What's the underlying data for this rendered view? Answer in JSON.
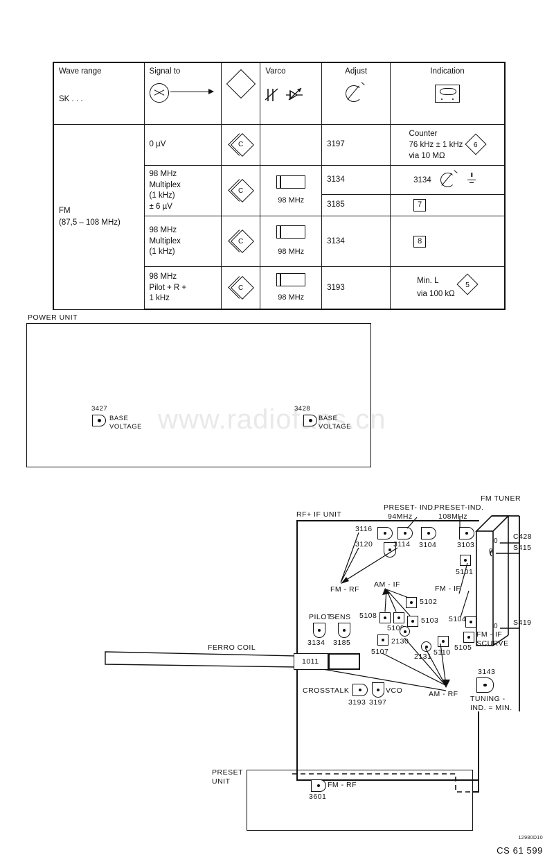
{
  "document": {
    "code_small": "12980D10",
    "code_large": "CS 61 599",
    "watermark": "www.radiofans.cn"
  },
  "alignment_table": {
    "headers": [
      {
        "label": "Wave range",
        "sub": "SK . . .",
        "icon": ""
      },
      {
        "label": "Signal to",
        "icon": "signal-generator-icon"
      },
      {
        "label": "",
        "icon": "diamond-icon"
      },
      {
        "label": "Varco",
        "icon": "varicap-symbols-icon"
      },
      {
        "label": "Adjust",
        "icon": "screwdriver-adjust-icon"
      },
      {
        "label": "Indication",
        "icon": "meter-icon"
      }
    ],
    "wave_range": {
      "band": "FM",
      "range": "(87,5 – 108 MHz)"
    },
    "rows": [
      {
        "signal": "0 µV",
        "connector": "C",
        "varco": "",
        "varco_freq": "",
        "adjust": "3197",
        "indication_lines": [
          "Counter",
          "76 kHz ± 1 kHz",
          "via 10 MΩ"
        ],
        "indication_badge": "6",
        "badge_shape": "diamond"
      },
      {
        "signal": "98 MHz\nMultiplex\n(1 kHz)\n± 6 µV",
        "signal_lines": [
          "98 MHz",
          "Multiplex",
          "(1 kHz)",
          "± 6 µV"
        ],
        "connector": "C",
        "varco": "coil",
        "varco_freq": "98 MHz",
        "adjust": "3134",
        "indication_value": "3134",
        "indication_symbols": [
          "screwdriver-adjust-icon",
          "ground-icon"
        ]
      },
      {
        "signal_lines": [],
        "adjust": "3185",
        "indication_badge": "7",
        "badge_shape": "square"
      },
      {
        "signal_lines": [
          "98 MHz",
          "Multiplex",
          "(1 kHz)"
        ],
        "connector": "C",
        "varco": "coil",
        "varco_freq": "98 MHz",
        "adjust": "3134",
        "indication_badge": "8",
        "badge_shape": "square"
      },
      {
        "signal_lines": [
          "98 MHz",
          "Pilot + R +",
          "1 kHz"
        ],
        "connector": "C",
        "varco": "coil",
        "varco_freq": "98 MHz",
        "adjust": "3193",
        "indication_lines": [
          "Min. L",
          "via 100 kΩ"
        ],
        "indication_badge": "5",
        "badge_shape": "diamond"
      }
    ]
  },
  "power_unit": {
    "title": "POWER  UNIT",
    "test_points": [
      {
        "id": "3427",
        "label_line1": "BASE",
        "label_line2": "VOLTAGE"
      },
      {
        "id": "3428",
        "label_line1": "BASE",
        "label_line2": "VOLTAGE"
      }
    ]
  },
  "rf_if_unit": {
    "title": "RF+ IF  UNIT",
    "fm_tuner_title": "FM  TUNER",
    "preset_unit_title_line1": "PRESET",
    "preset_unit_title_line2": "UNIT",
    "ferro_coil_label": "FERRO  COIL",
    "ferrite_part": "1011",
    "preset_ind_94": {
      "line1": "PRESET- IND.",
      "line2": "94MHz"
    },
    "preset_ind_108": {
      "line1": "PRESET-IND.",
      "line2": "108MHz"
    },
    "group_labels": {
      "fm_rf": "FM - RF",
      "am_if": "AM - IF",
      "fm_if": "FM - IF",
      "am_rf": "AM - RF",
      "pilot": "PILOT -",
      "sens": "SENS",
      "crosstalk": "CROSSTALK",
      "vco": "VCO",
      "fm_if_scurve_line1": "FM - IF",
      "fm_if_scurve_line2": "SCURVE",
      "tuning_line1": "TUNING -",
      "tuning_line2": "IND. = MIN.",
      "fm_rf_preset": "FM - RF"
    },
    "components": {
      "c3116": "3116",
      "c3120": "3120",
      "c3114": "3114",
      "c3104": "3104",
      "c3103": "3103",
      "c5101": "5101",
      "c5102": "5102",
      "c5103": "5103",
      "c5104": "5104",
      "c5105": "5105",
      "c5107": "5107",
      "c5108": "5108",
      "c5109": "5109",
      "c5110": "5110",
      "c2130": "2130",
      "c2131": "2131",
      "c3134": "3134",
      "c3185": "3185",
      "c3193": "3193",
      "c3197": "3197",
      "c3143": "3143",
      "c3601": "3601"
    },
    "tuner_terminals": [
      {
        "zero": "0",
        "name": "C428"
      },
      {
        "zero": "0",
        "name": "S415"
      },
      {
        "zero": "0",
        "name": "S419"
      }
    ]
  }
}
